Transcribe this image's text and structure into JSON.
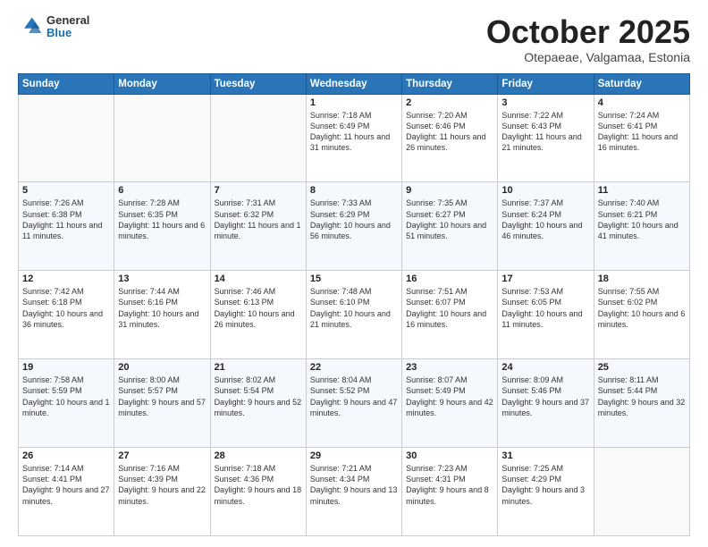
{
  "header": {
    "logo_general": "General",
    "logo_blue": "Blue",
    "month_title": "October 2025",
    "subtitle": "Otepaeae, Valgamaa, Estonia"
  },
  "weekdays": [
    "Sunday",
    "Monday",
    "Tuesday",
    "Wednesday",
    "Thursday",
    "Friday",
    "Saturday"
  ],
  "weeks": [
    [
      {
        "day": "",
        "sunrise": "",
        "sunset": "",
        "daylight": ""
      },
      {
        "day": "",
        "sunrise": "",
        "sunset": "",
        "daylight": ""
      },
      {
        "day": "",
        "sunrise": "",
        "sunset": "",
        "daylight": ""
      },
      {
        "day": "1",
        "sunrise": "Sunrise: 7:18 AM",
        "sunset": "Sunset: 6:49 PM",
        "daylight": "Daylight: 11 hours and 31 minutes."
      },
      {
        "day": "2",
        "sunrise": "Sunrise: 7:20 AM",
        "sunset": "Sunset: 6:46 PM",
        "daylight": "Daylight: 11 hours and 26 minutes."
      },
      {
        "day": "3",
        "sunrise": "Sunrise: 7:22 AM",
        "sunset": "Sunset: 6:43 PM",
        "daylight": "Daylight: 11 hours and 21 minutes."
      },
      {
        "day": "4",
        "sunrise": "Sunrise: 7:24 AM",
        "sunset": "Sunset: 6:41 PM",
        "daylight": "Daylight: 11 hours and 16 minutes."
      }
    ],
    [
      {
        "day": "5",
        "sunrise": "Sunrise: 7:26 AM",
        "sunset": "Sunset: 6:38 PM",
        "daylight": "Daylight: 11 hours and 11 minutes."
      },
      {
        "day": "6",
        "sunrise": "Sunrise: 7:28 AM",
        "sunset": "Sunset: 6:35 PM",
        "daylight": "Daylight: 11 hours and 6 minutes."
      },
      {
        "day": "7",
        "sunrise": "Sunrise: 7:31 AM",
        "sunset": "Sunset: 6:32 PM",
        "daylight": "Daylight: 11 hours and 1 minute."
      },
      {
        "day": "8",
        "sunrise": "Sunrise: 7:33 AM",
        "sunset": "Sunset: 6:29 PM",
        "daylight": "Daylight: 10 hours and 56 minutes."
      },
      {
        "day": "9",
        "sunrise": "Sunrise: 7:35 AM",
        "sunset": "Sunset: 6:27 PM",
        "daylight": "Daylight: 10 hours and 51 minutes."
      },
      {
        "day": "10",
        "sunrise": "Sunrise: 7:37 AM",
        "sunset": "Sunset: 6:24 PM",
        "daylight": "Daylight: 10 hours and 46 minutes."
      },
      {
        "day": "11",
        "sunrise": "Sunrise: 7:40 AM",
        "sunset": "Sunset: 6:21 PM",
        "daylight": "Daylight: 10 hours and 41 minutes."
      }
    ],
    [
      {
        "day": "12",
        "sunrise": "Sunrise: 7:42 AM",
        "sunset": "Sunset: 6:18 PM",
        "daylight": "Daylight: 10 hours and 36 minutes."
      },
      {
        "day": "13",
        "sunrise": "Sunrise: 7:44 AM",
        "sunset": "Sunset: 6:16 PM",
        "daylight": "Daylight: 10 hours and 31 minutes."
      },
      {
        "day": "14",
        "sunrise": "Sunrise: 7:46 AM",
        "sunset": "Sunset: 6:13 PM",
        "daylight": "Daylight: 10 hours and 26 minutes."
      },
      {
        "day": "15",
        "sunrise": "Sunrise: 7:48 AM",
        "sunset": "Sunset: 6:10 PM",
        "daylight": "Daylight: 10 hours and 21 minutes."
      },
      {
        "day": "16",
        "sunrise": "Sunrise: 7:51 AM",
        "sunset": "Sunset: 6:07 PM",
        "daylight": "Daylight: 10 hours and 16 minutes."
      },
      {
        "day": "17",
        "sunrise": "Sunrise: 7:53 AM",
        "sunset": "Sunset: 6:05 PM",
        "daylight": "Daylight: 10 hours and 11 minutes."
      },
      {
        "day": "18",
        "sunrise": "Sunrise: 7:55 AM",
        "sunset": "Sunset: 6:02 PM",
        "daylight": "Daylight: 10 hours and 6 minutes."
      }
    ],
    [
      {
        "day": "19",
        "sunrise": "Sunrise: 7:58 AM",
        "sunset": "Sunset: 5:59 PM",
        "daylight": "Daylight: 10 hours and 1 minute."
      },
      {
        "day": "20",
        "sunrise": "Sunrise: 8:00 AM",
        "sunset": "Sunset: 5:57 PM",
        "daylight": "Daylight: 9 hours and 57 minutes."
      },
      {
        "day": "21",
        "sunrise": "Sunrise: 8:02 AM",
        "sunset": "Sunset: 5:54 PM",
        "daylight": "Daylight: 9 hours and 52 minutes."
      },
      {
        "day": "22",
        "sunrise": "Sunrise: 8:04 AM",
        "sunset": "Sunset: 5:52 PM",
        "daylight": "Daylight: 9 hours and 47 minutes."
      },
      {
        "day": "23",
        "sunrise": "Sunrise: 8:07 AM",
        "sunset": "Sunset: 5:49 PM",
        "daylight": "Daylight: 9 hours and 42 minutes."
      },
      {
        "day": "24",
        "sunrise": "Sunrise: 8:09 AM",
        "sunset": "Sunset: 5:46 PM",
        "daylight": "Daylight: 9 hours and 37 minutes."
      },
      {
        "day": "25",
        "sunrise": "Sunrise: 8:11 AM",
        "sunset": "Sunset: 5:44 PM",
        "daylight": "Daylight: 9 hours and 32 minutes."
      }
    ],
    [
      {
        "day": "26",
        "sunrise": "Sunrise: 7:14 AM",
        "sunset": "Sunset: 4:41 PM",
        "daylight": "Daylight: 9 hours and 27 minutes."
      },
      {
        "day": "27",
        "sunrise": "Sunrise: 7:16 AM",
        "sunset": "Sunset: 4:39 PM",
        "daylight": "Daylight: 9 hours and 22 minutes."
      },
      {
        "day": "28",
        "sunrise": "Sunrise: 7:18 AM",
        "sunset": "Sunset: 4:36 PM",
        "daylight": "Daylight: 9 hours and 18 minutes."
      },
      {
        "day": "29",
        "sunrise": "Sunrise: 7:21 AM",
        "sunset": "Sunset: 4:34 PM",
        "daylight": "Daylight: 9 hours and 13 minutes."
      },
      {
        "day": "30",
        "sunrise": "Sunrise: 7:23 AM",
        "sunset": "Sunset: 4:31 PM",
        "daylight": "Daylight: 9 hours and 8 minutes."
      },
      {
        "day": "31",
        "sunrise": "Sunrise: 7:25 AM",
        "sunset": "Sunset: 4:29 PM",
        "daylight": "Daylight: 9 hours and 3 minutes."
      },
      {
        "day": "",
        "sunrise": "",
        "sunset": "",
        "daylight": ""
      }
    ]
  ]
}
